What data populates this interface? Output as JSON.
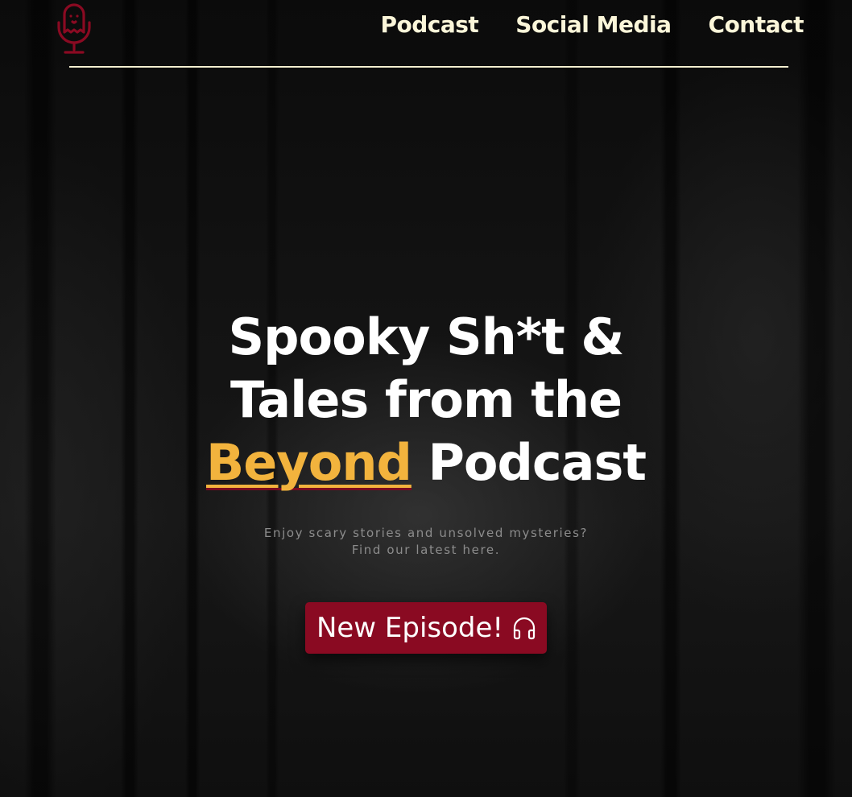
{
  "nav": {
    "logo_icon": "ghost-microphone-icon",
    "links": [
      {
        "label": "Podcast"
      },
      {
        "label": "Social Media"
      },
      {
        "label": "Contact"
      }
    ]
  },
  "hero": {
    "title_line1": "Spooky Sh*t &",
    "title_line2": "Tales from the",
    "title_accent": "Beyond",
    "title_end": "Podcast",
    "subtitle_line1": "Enjoy scary stories and unsolved mysteries?",
    "subtitle_line2": "Find our latest here.",
    "cta_label": "New Episode!",
    "cta_icon": "headphones-icon"
  },
  "colors": {
    "nav_text": "#fbf6d9",
    "accent": "#f2b33d",
    "brand_red": "#8a0a22"
  }
}
